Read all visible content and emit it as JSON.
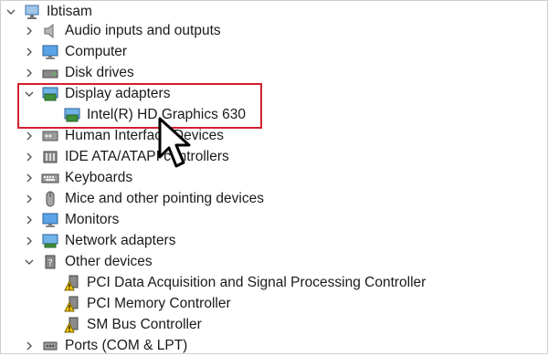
{
  "root": {
    "label": "Ibtisam",
    "icon": "computer-icon"
  },
  "items": [
    {
      "label": "Audio inputs and outputs",
      "icon": "speaker-icon",
      "expanded": false
    },
    {
      "label": "Computer",
      "icon": "monitor-icon",
      "expanded": false
    },
    {
      "label": "Disk drives",
      "icon": "disk-drive-icon",
      "expanded": false
    },
    {
      "label": "Display adapters",
      "icon": "display-adapter-icon",
      "expanded": true,
      "children": [
        {
          "label": "Intel(R) HD Graphics 630",
          "icon": "display-adapter-icon"
        }
      ]
    },
    {
      "label": "Human Interface Devices",
      "icon": "hid-icon",
      "expanded": false
    },
    {
      "label": "IDE ATA/ATAPI controllers",
      "icon": "ide-controller-icon",
      "expanded": false
    },
    {
      "label": "Keyboards",
      "icon": "keyboard-icon",
      "expanded": false
    },
    {
      "label": "Mice and other pointing devices",
      "icon": "mouse-icon",
      "expanded": false
    },
    {
      "label": "Monitors",
      "icon": "monitor-icon",
      "expanded": false
    },
    {
      "label": "Network adapters",
      "icon": "network-adapter-icon",
      "expanded": false
    },
    {
      "label": "Other devices",
      "icon": "other-devices-icon",
      "expanded": true,
      "children": [
        {
          "label": "PCI Data Acquisition and Signal Processing Controller",
          "icon": "warning-device-icon"
        },
        {
          "label": "PCI Memory Controller",
          "icon": "warning-device-icon"
        },
        {
          "label": "SM Bus Controller",
          "icon": "warning-device-icon"
        }
      ]
    },
    {
      "label": "Ports (COM & LPT)",
      "icon": "port-icon",
      "expanded": false
    }
  ],
  "colors": {
    "highlight_border": "#d2202f",
    "icon_blue": "#2f7fd0",
    "icon_green": "#3f8f3a"
  }
}
